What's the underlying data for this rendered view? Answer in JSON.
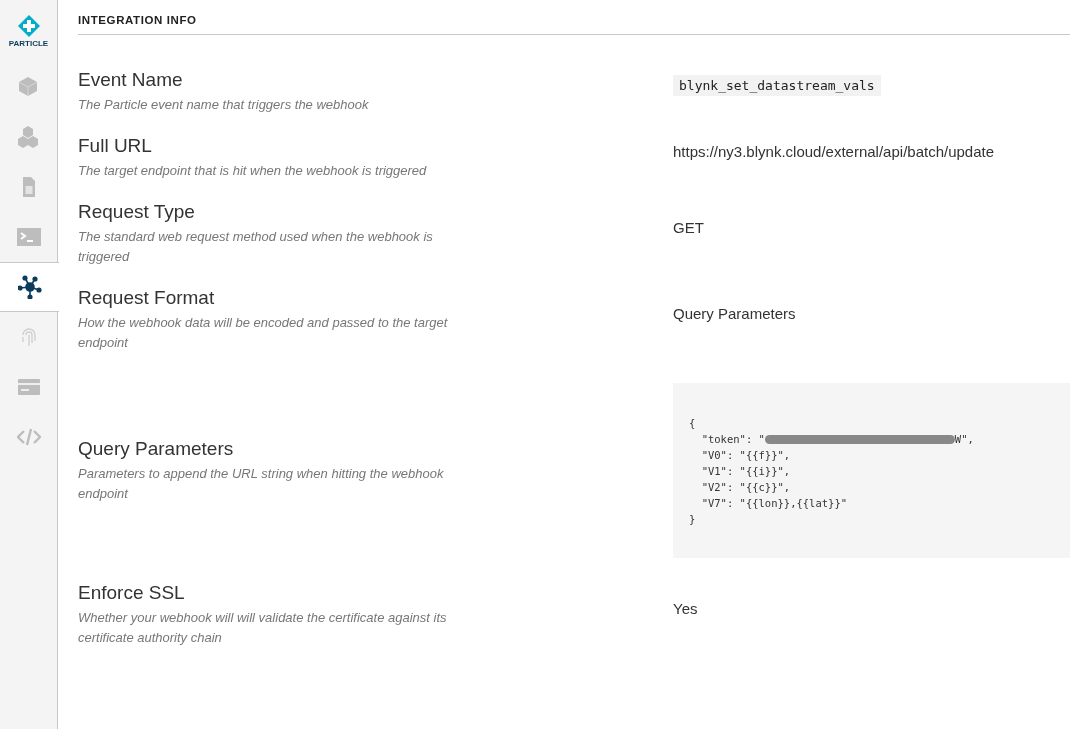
{
  "sidebar": {
    "logo_text": "PARTICLE",
    "items": [
      {
        "kind": "cube",
        "selected": false
      },
      {
        "kind": "cubes",
        "selected": false
      },
      {
        "kind": "sim",
        "selected": false
      },
      {
        "kind": "terminal",
        "selected": false
      },
      {
        "kind": "network",
        "selected": true
      },
      {
        "kind": "fingerprint",
        "selected": false
      },
      {
        "kind": "card",
        "selected": false
      },
      {
        "kind": "code",
        "selected": false
      }
    ]
  },
  "section": {
    "title": "INTEGRATION INFO"
  },
  "fields": [
    {
      "label": "Event Name",
      "description": "The Particle event name that triggers the webhook",
      "kind": "chip",
      "value": "blynk_set_datastream_vals"
    },
    {
      "label": "Full URL",
      "description": "The target endpoint that is hit when the webhook is triggered",
      "kind": "text",
      "value": "https://ny3.blynk.cloud/external/api/batch/update"
    },
    {
      "label": "Request Type",
      "description": "The standard web request method used when the webhook is triggered",
      "kind": "text",
      "value": "GET"
    },
    {
      "label": "Request Format",
      "description": "How the webhook data will be encoded and passed to the target endpoint",
      "kind": "text",
      "value": "Query Parameters"
    },
    {
      "label": "Query Parameters",
      "description": "Parameters to append the URL string when hitting the webhook endpoint",
      "kind": "code",
      "lines": [
        {
          "text": "{"
        },
        {
          "text": "  \"token\": \"",
          "redacted": true,
          "after": "W\","
        },
        {
          "text": "  \"V0\": \"{{f}}\","
        },
        {
          "text": "  \"V1\": \"{{i}}\","
        },
        {
          "text": "  \"V2\": \"{{c}}\","
        },
        {
          "text": "  \"V7\": \"{{lon}},{{lat}}\""
        },
        {
          "text": "}"
        }
      ]
    },
    {
      "label": "Enforce SSL",
      "description": "Whether your webhook will will validate the certificate against its certificate authority chain",
      "kind": "text",
      "value": "Yes"
    }
  ]
}
